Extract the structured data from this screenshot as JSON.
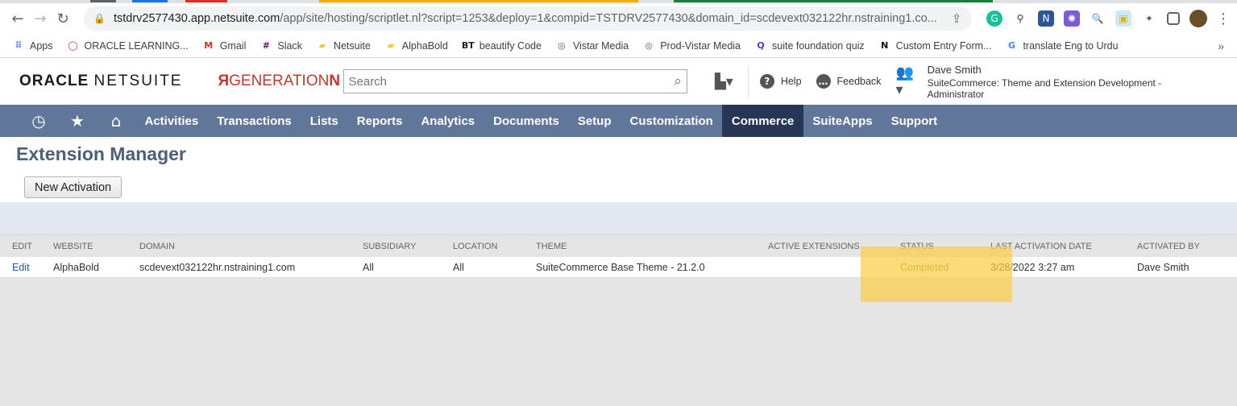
{
  "browser": {
    "url_host": "tstdrv2577430.app.netsuite.com",
    "url_path": "/app/site/hosting/scriptlet.nl?script=1253&deploy=1&compid=TSTDRV2577430&domain_id=scdevext032122hr.nstraining1.co...",
    "bookmarks": [
      {
        "label": "Apps",
        "icon": "apps-grid-icon",
        "color": "#4285f4"
      },
      {
        "label": "ORACLE LEARNING...",
        "icon": "oracle-icon",
        "color": "#c74634"
      },
      {
        "label": "Gmail",
        "icon": "gmail-icon",
        "color": "#d93025"
      },
      {
        "label": "Slack",
        "icon": "slack-icon",
        "color": "#611f69"
      },
      {
        "label": "Netsuite",
        "icon": "folder-icon",
        "color": "#f6c344"
      },
      {
        "label": "AlphaBold",
        "icon": "folder-icon",
        "color": "#f6c344"
      },
      {
        "label": "beautify Code",
        "icon": "bt-icon",
        "color": "#222222"
      },
      {
        "label": "Vistar Media",
        "icon": "globe-icon",
        "color": "#5f6368"
      },
      {
        "label": "Prod-Vistar Media",
        "icon": "globe-icon",
        "color": "#5f6368"
      },
      {
        "label": "suite foundation quiz",
        "icon": "quiz-icon",
        "color": "#4b3bd6"
      },
      {
        "label": "Custom Entry Form...",
        "icon": "notion-icon",
        "color": "#111111"
      },
      {
        "label": "translate Eng to Urdu",
        "icon": "google-icon",
        "color": "#4285f4"
      }
    ]
  },
  "header": {
    "logo_bold": "ORACLE",
    "logo_light": "NETSUITE",
    "partner_logo": "GENERATION",
    "partner_logo_end": "N",
    "search_placeholder": "Search",
    "help_label": "Help",
    "feedback_label": "Feedback",
    "user_name": "Dave Smith",
    "user_role": "SuiteCommerce: Theme and Extension Development - Administrator"
  },
  "nav": {
    "items": [
      "Activities",
      "Transactions",
      "Lists",
      "Reports",
      "Analytics",
      "Documents",
      "Setup",
      "Customization",
      "Commerce",
      "SuiteApps",
      "Support"
    ],
    "active": "Commerce"
  },
  "page": {
    "title": "Extension Manager",
    "new_activation_label": "New Activation"
  },
  "table": {
    "columns": [
      "EDIT",
      "WEBSITE",
      "DOMAIN",
      "SUBSIDIARY",
      "LOCATION",
      "THEME",
      "ACTIVE EXTENSIONS",
      "STATUS",
      "LAST ACTIVATION DATE",
      "ACTIVATED BY"
    ],
    "rows": [
      {
        "edit": "Edit",
        "website": "AlphaBold",
        "domain": "scdevext032122hr.nstraining1.com",
        "subsidiary": "All",
        "location": "All",
        "theme": "SuiteCommerce Base Theme - 21.2.0",
        "active_extensions": "",
        "status": "Completed",
        "last_activation_date": "3/28/2022 3:27 am",
        "activated_by": "Dave Smith"
      }
    ]
  },
  "colors": {
    "nav_bg": "#607799",
    "nav_active": "#253754",
    "title": "#4d5f79",
    "highlight": "#facd46"
  }
}
